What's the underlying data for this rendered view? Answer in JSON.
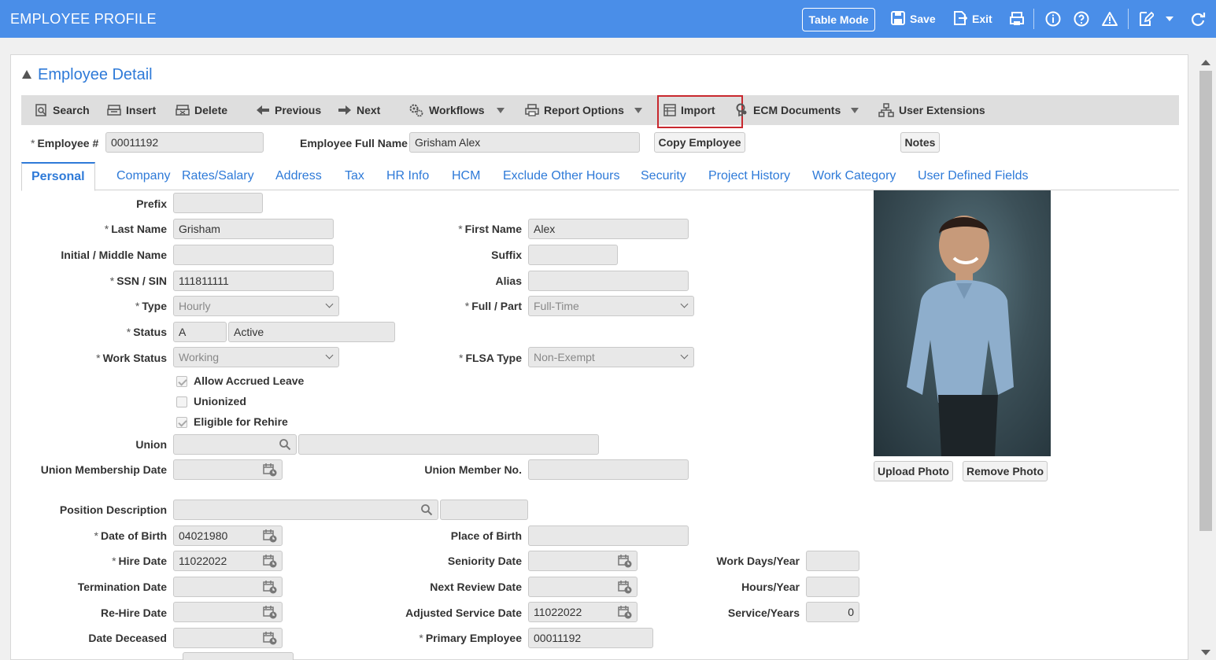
{
  "header": {
    "title": "EMPLOYEE PROFILE",
    "table_mode": "Table Mode",
    "save": "Save",
    "exit": "Exit"
  },
  "panel": {
    "title": "Employee Detail"
  },
  "toolbar": {
    "search": "Search",
    "insert": "Insert",
    "delete": "Delete",
    "previous": "Previous",
    "next": "Next",
    "workflows": "Workflows",
    "report_options": "Report Options",
    "import": "Import",
    "ecm_documents": "ECM Documents",
    "user_extensions": "User Extensions"
  },
  "top_fields": {
    "employee_no_label": "Employee #",
    "employee_no": "00011192",
    "full_name_label": "Employee Full Name",
    "full_name": "Grisham Alex",
    "copy_employee": "Copy Employee",
    "notes": "Notes"
  },
  "tabs": [
    "Personal",
    "Company",
    "Rates/Salary",
    "Address",
    "Tax",
    "HR Info",
    "HCM",
    "Exclude Other Hours",
    "Security",
    "Project History",
    "Work Category",
    "User Defined Fields"
  ],
  "personal": {
    "prefix_label": "Prefix",
    "prefix": "",
    "last_name_label": "Last Name",
    "last_name": "Grisham",
    "first_name_label": "First Name",
    "first_name": "Alex",
    "middle_label": "Initial / Middle Name",
    "middle": "",
    "suffix_label": "Suffix",
    "suffix": "",
    "ssn_label": "SSN / SIN",
    "ssn": "111811111",
    "alias_label": "Alias",
    "alias": "",
    "type_label": "Type",
    "type": "Hourly",
    "full_part_label": "Full / Part",
    "full_part": "Full-Time",
    "status_label": "Status",
    "status_code": "A",
    "status_desc": "Active",
    "work_status_label": "Work Status",
    "work_status": "Working",
    "flsa_label": "FLSA Type",
    "flsa": "Non-Exempt",
    "allow_accrued": "Allow Accrued Leave",
    "unionized": "Unionized",
    "eligible_rehire": "Eligible for Rehire",
    "union_label": "Union",
    "union": "",
    "union_desc": "",
    "union_membership_date_label": "Union Membership Date",
    "union_membership_date": "",
    "union_member_no_label": "Union Member No.",
    "union_member_no": "",
    "position_label": "Position Description",
    "position": "",
    "position_code": "",
    "dob_label": "Date of Birth",
    "dob": "04021980",
    "place_of_birth_label": "Place of Birth",
    "place_of_birth": "",
    "hire_date_label": "Hire Date",
    "hire_date": "11022022",
    "seniority_date_label": "Seniority Date",
    "seniority_date": "",
    "work_days_label": "Work Days/Year",
    "work_days": "",
    "termination_date_label": "Termination Date",
    "termination_date": "",
    "next_review_label": "Next Review Date",
    "next_review": "",
    "hours_year_label": "Hours/Year",
    "hours_year": "",
    "rehire_date_label": "Re-Hire Date",
    "rehire_date": "",
    "adjusted_service_label": "Adjusted Service Date",
    "adjusted_service": "11022022",
    "service_years_label": "Service/Years",
    "service_years": "0",
    "date_deceased_label": "Date Deceased",
    "date_deceased": "",
    "primary_employee_label": "Primary Employee",
    "primary_employee": "00011192",
    "req_marker": "*"
  },
  "photo": {
    "upload": "Upload Photo",
    "remove": "Remove Photo"
  },
  "colors": {
    "header_bg": "#4a8ee8",
    "link": "#2e7ad8",
    "highlight": "#c8282e"
  }
}
